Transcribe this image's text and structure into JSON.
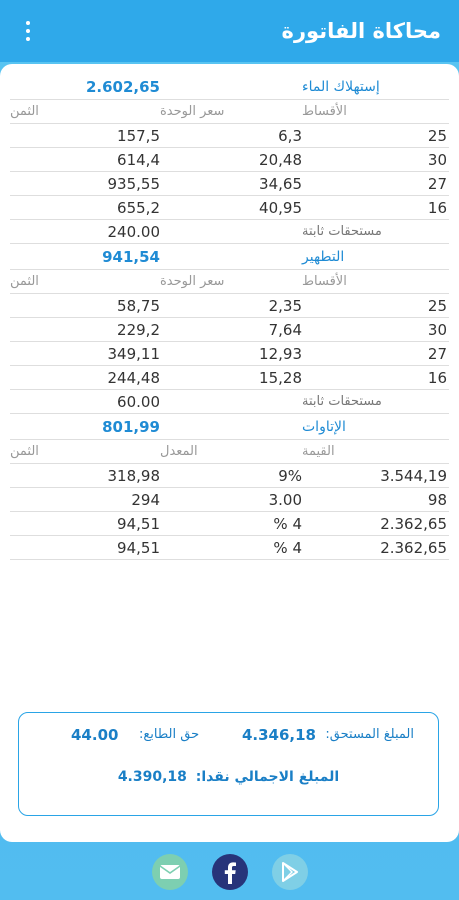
{
  "appbar": {
    "title": "محاكاة الفاتورة",
    "menu_icon": "more-vert-icon"
  },
  "water": {
    "title": "إستهلاك الماء",
    "total": "2.602,65",
    "headers": {
      "installments": "الأقساط",
      "unit_price": "سعر الوحدة",
      "price": "الثمن"
    },
    "rows": [
      {
        "qty": "25",
        "unit": "6,3",
        "price": "157,5"
      },
      {
        "qty": "30",
        "unit": "20,48",
        "price": "614,4"
      },
      {
        "qty": "27",
        "unit": "34,65",
        "price": "935,55"
      },
      {
        "qty": "16",
        "unit": "40,95",
        "price": "655,2"
      }
    ],
    "fixed_label": "مستحقات ثابتة",
    "fixed_value": "240.00"
  },
  "sanitation": {
    "title": "التطهير",
    "total": "941,54",
    "headers": {
      "installments": "الأقساط",
      "unit_price": "سعر الوحدة",
      "price": "الثمن"
    },
    "rows": [
      {
        "qty": "25",
        "unit": "2,35",
        "price": "58,75"
      },
      {
        "qty": "30",
        "unit": "7,64",
        "price": "229,2"
      },
      {
        "qty": "27",
        "unit": "12,93",
        "price": "349,11"
      },
      {
        "qty": "16",
        "unit": "15,28",
        "price": "244,48"
      }
    ],
    "fixed_label": "مستحقات ثابتة",
    "fixed_value": "60.00"
  },
  "royalties": {
    "title": "الإتاوات",
    "total": "801,99",
    "headers": {
      "value": "القيمة",
      "rate": "المعدل",
      "price": "الثمن"
    },
    "rows": [
      {
        "value": "3.544,19",
        "rate": "9%",
        "price": "318,98"
      },
      {
        "value": "98",
        "rate": "3.00",
        "price": "294"
      },
      {
        "value": "2.362,65",
        "rate": "% 4",
        "price": "94,51"
      },
      {
        "value": "2.362,65",
        "rate": "% 4",
        "price": "94,51"
      }
    ]
  },
  "summary": {
    "due_label": "المبلغ المستحق:",
    "due_value": "4.346,18",
    "stamp_label": "حق الطابع:",
    "stamp_value": "44.00",
    "total_label": "المبلغ الاجمالي نقدا:",
    "total_value": "4.390,18"
  },
  "colors": {
    "appbar": "#2fa9ea",
    "accent": "#1f8bd4",
    "background": "#52bdf0"
  },
  "share": {
    "icons": [
      "mail-icon",
      "facebook-icon",
      "google-play-icon"
    ]
  }
}
